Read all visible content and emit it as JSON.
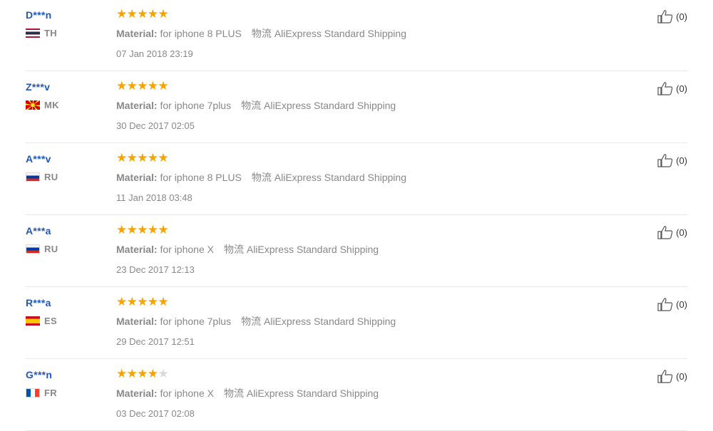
{
  "colors": {
    "name": "#2158b8",
    "star": "#f7a300",
    "star_empty": "#d9d9d9",
    "muted": "#888888",
    "divider": "#e8e8e8"
  },
  "reviews": [
    {
      "user": "D***n",
      "country": "TH",
      "flag_icon": "thailand-flag-icon",
      "rating": 5,
      "attr_key": "Material:",
      "attr_value": "for iphone 8 PLUS",
      "shipping": "物流 AliExpress Standard Shipping",
      "date": "07 Jan 2018 23:19",
      "helpful": "(0)"
    },
    {
      "user": "Z***v",
      "country": "MK",
      "flag_icon": "macedonia-flag-icon",
      "rating": 5,
      "attr_key": "Material:",
      "attr_value": "for iphone 7plus",
      "shipping": "物流 AliExpress Standard Shipping",
      "date": "30 Dec 2017 02:05",
      "helpful": "(0)"
    },
    {
      "user": "A***v",
      "country": "RU",
      "flag_icon": "russia-flag-icon",
      "rating": 5,
      "attr_key": "Material:",
      "attr_value": "for iphone 8 PLUS",
      "shipping": "物流 AliExpress Standard Shipping",
      "date": "11 Jan 2018 03:48",
      "helpful": "(0)"
    },
    {
      "user": "A***a",
      "country": "RU",
      "flag_icon": "russia-flag-icon",
      "rating": 5,
      "attr_key": "Material:",
      "attr_value": "for iphone X",
      "shipping": "物流 AliExpress Standard Shipping",
      "date": "23 Dec 2017 12:13",
      "helpful": "(0)"
    },
    {
      "user": "R***a",
      "country": "ES",
      "flag_icon": "spain-flag-icon",
      "rating": 5,
      "attr_key": "Material:",
      "attr_value": "for iphone 7plus",
      "shipping": "物流 AliExpress Standard Shipping",
      "date": "29 Dec 2017 12:51",
      "helpful": "(0)"
    },
    {
      "user": "G***n",
      "country": "FR",
      "flag_icon": "france-flag-icon",
      "rating": 4,
      "attr_key": "Material:",
      "attr_value": "for iphone X",
      "shipping": "物流 AliExpress Standard Shipping",
      "date": "03 Dec 2017 02:08",
      "helpful": "(0)"
    }
  ]
}
